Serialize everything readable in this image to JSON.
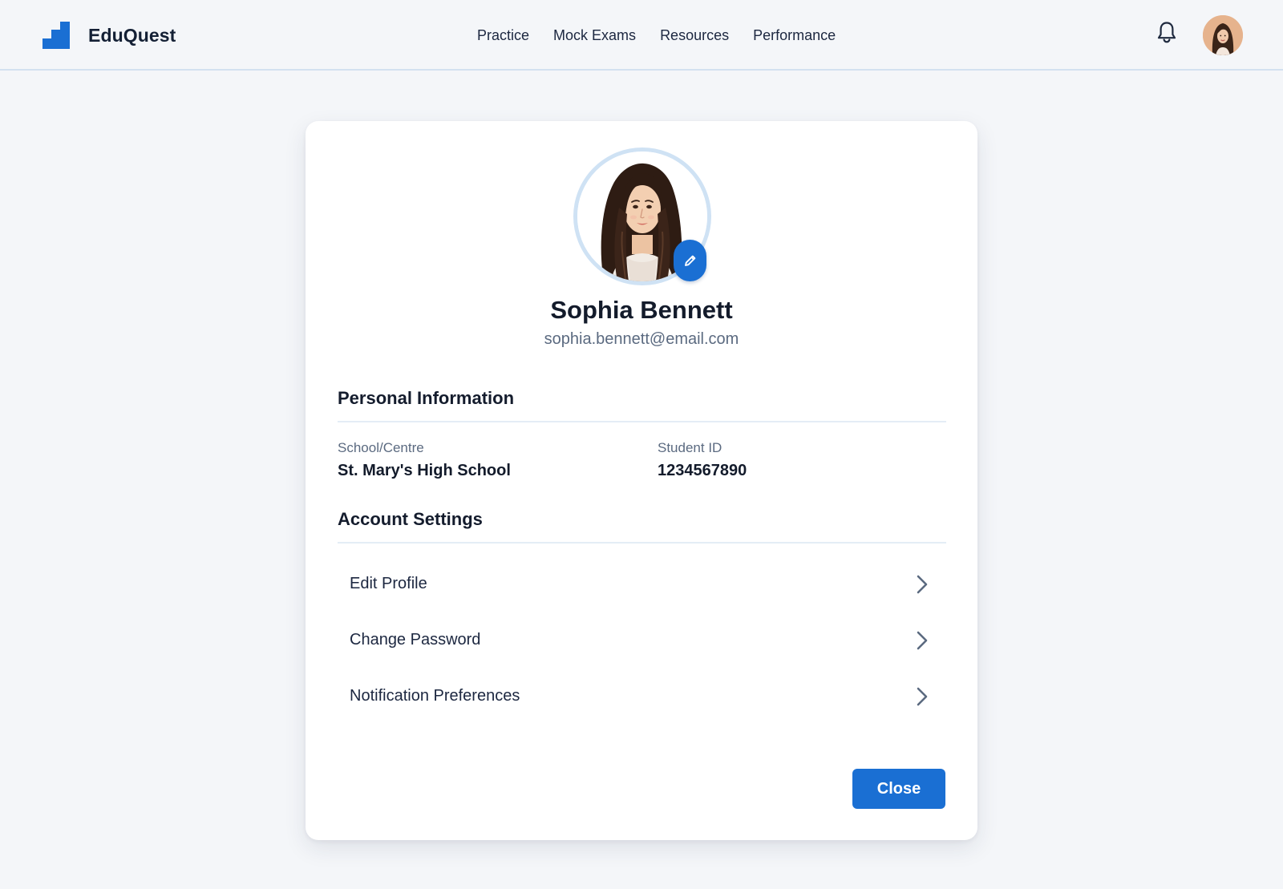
{
  "header": {
    "brand_name": "EduQuest",
    "logo_icon": "staircase-logo-icon",
    "nav": [
      {
        "label": "Practice"
      },
      {
        "label": "Mock Exams"
      },
      {
        "label": "Resources"
      },
      {
        "label": "Performance"
      }
    ],
    "notification_icon": "bell-icon",
    "avatar_icon": "user-avatar"
  },
  "profile": {
    "name": "Sophia Bennett",
    "email": "sophia.bennett@email.com",
    "edit_photo_icon": "pencil-icon"
  },
  "personal_info": {
    "title": "Personal Information",
    "fields": [
      {
        "label": "School/Centre",
        "value": "St. Mary's High School"
      },
      {
        "label": "Student ID",
        "value": "1234567890"
      }
    ]
  },
  "account_settings": {
    "title": "Account Settings",
    "items": [
      {
        "label": "Edit Profile",
        "icon": "chevron-right-icon"
      },
      {
        "label": "Change Password",
        "icon": "chevron-right-icon"
      },
      {
        "label": "Notification Preferences",
        "icon": "chevron-right-icon"
      }
    ]
  },
  "actions": {
    "close_label": "Close"
  },
  "colors": {
    "accent": "#1a6fd3",
    "background": "#f4f6f9",
    "card": "#ffffff",
    "muted_text": "#5b6a80",
    "avatar_ring": "#cfe2f4"
  }
}
